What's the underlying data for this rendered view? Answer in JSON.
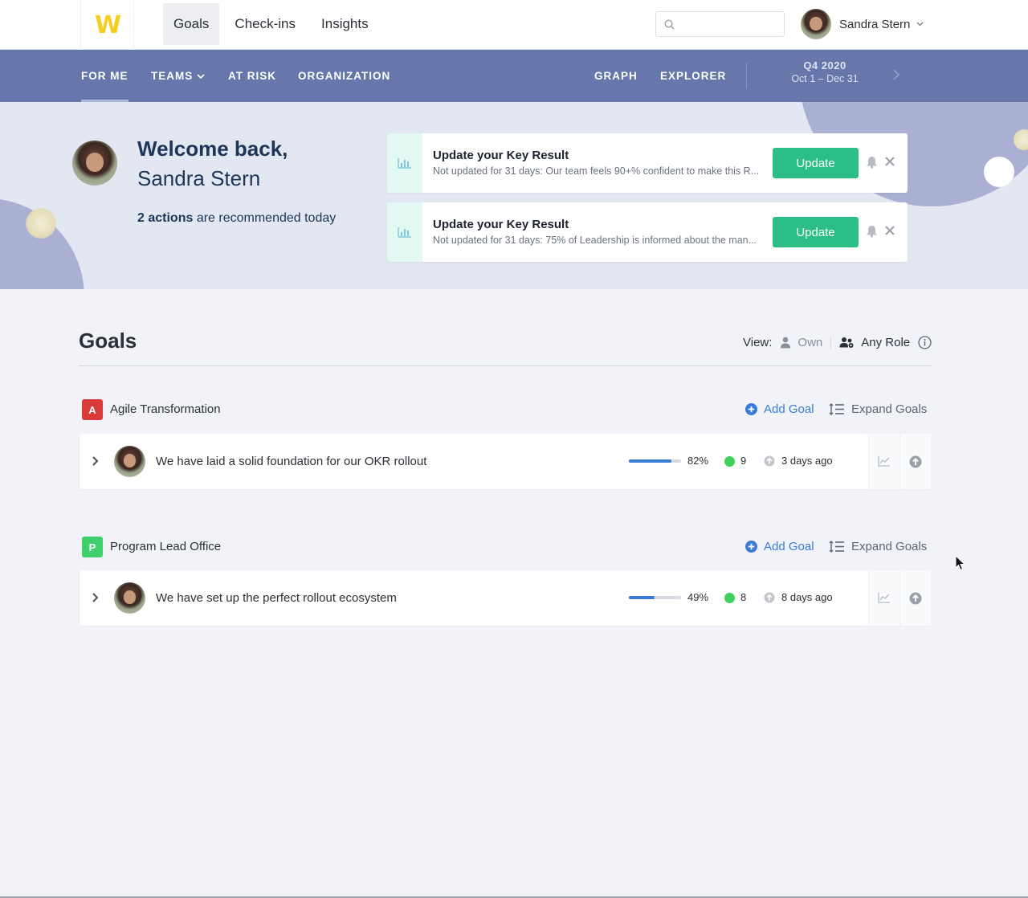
{
  "header": {
    "logo": "W",
    "nav": [
      "Goals",
      "Check-ins",
      "Insights"
    ],
    "search": {
      "placeholder": ""
    },
    "user": {
      "name": "Sandra Stern"
    }
  },
  "subnav": {
    "tabs": [
      "FOR ME",
      "TEAMS",
      "AT RISK",
      "ORGANIZATION"
    ],
    "right_tabs": [
      "GRAPH",
      "EXPLORER"
    ],
    "quarter": {
      "label": "Q4 2020",
      "range": "Oct 1 – Dec 31"
    }
  },
  "hero": {
    "greeting": "Welcome back,",
    "name": "Sandra Stern",
    "actions_count": "2 actions",
    "actions_text": "are recommended today",
    "cards": [
      {
        "title": "Update your Key Result",
        "subtitle": "Not updated for 31 days: Our team feels 90+% confident to make this R...",
        "button": "Update"
      },
      {
        "title": "Update your Key Result",
        "subtitle": "Not updated for 31 days: 75% of Leadership is informed about the man...",
        "button": "Update"
      }
    ]
  },
  "goals": {
    "title": "Goals",
    "view_label": "View:",
    "view_options": [
      "Own",
      "Any Role"
    ],
    "groups": [
      {
        "badge": "A",
        "badge_color": "#d93a3a",
        "name": "Agile Transformation",
        "add_label": "Add Goal",
        "expand_label": "Expand Goals",
        "goal": {
          "title": "We have laid a solid foundation for our OKR rollout",
          "progress": 0.82,
          "progress_label": "82%",
          "count": "9",
          "updated": "3 days ago"
        }
      },
      {
        "badge": "P",
        "badge_color": "#3fcf6b",
        "name": "Program Lead Office",
        "add_label": "Add Goal",
        "expand_label": "Expand Goals",
        "goal": {
          "title": "We have set up the perfect rollout ecosystem",
          "progress": 0.49,
          "progress_label": "49%",
          "count": "8",
          "updated": "8 days ago"
        }
      }
    ]
  },
  "colors": {
    "accent": "#3a7bd5",
    "subnav": "#6577ab",
    "update_button": "#2bbf87",
    "status_green": "#3fd15b"
  }
}
